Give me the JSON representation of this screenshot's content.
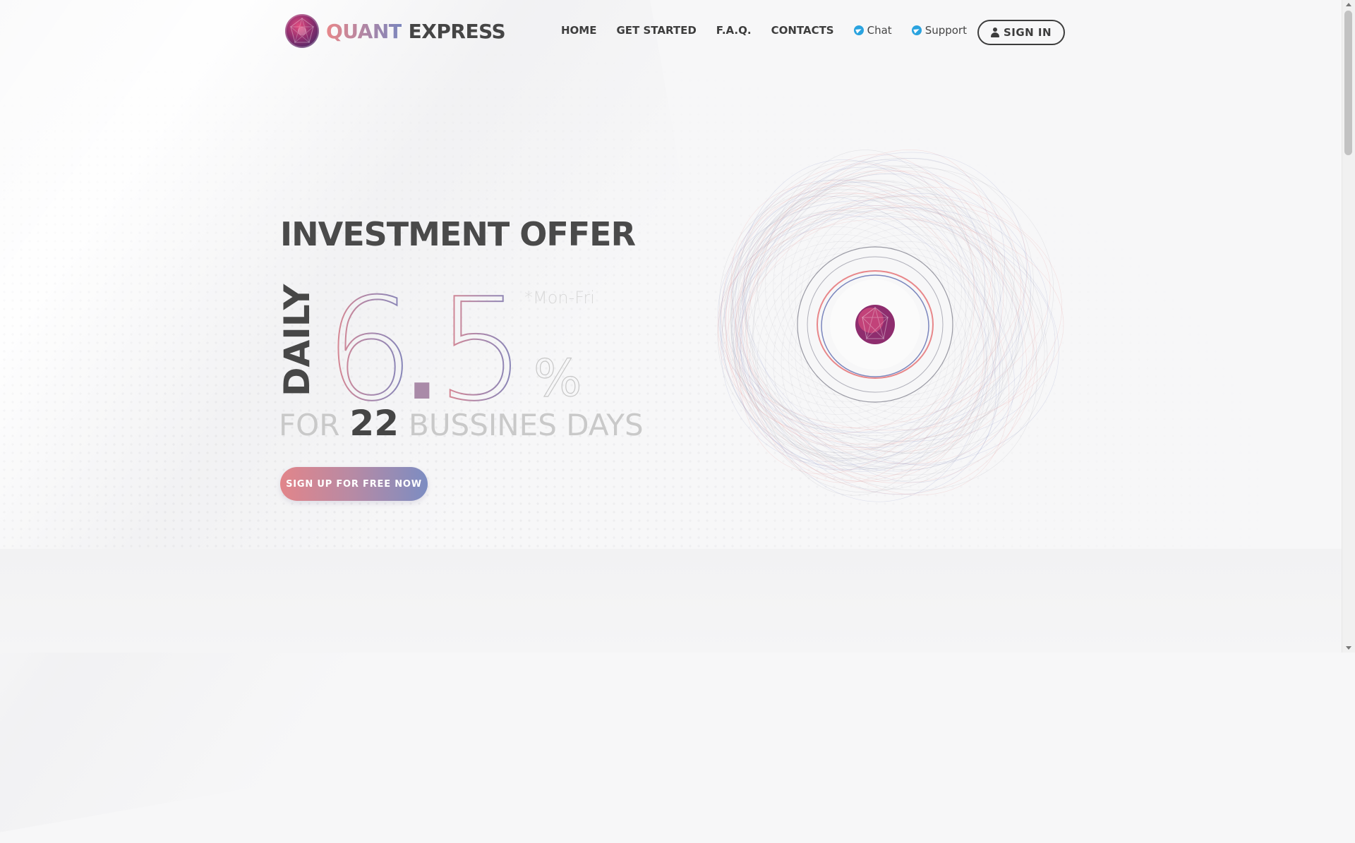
{
  "brand": {
    "word1": "QUANT",
    "word2": "EXPRESS",
    "logo_icon": "crystal-gem-logo"
  },
  "nav": {
    "home": "HOME",
    "get_started": "GET STARTED",
    "faq": "F.A.Q.",
    "contacts": "CONTACTS",
    "chat": "Chat",
    "support": "Support",
    "chat_icon": "telegram-icon",
    "support_icon": "telegram-icon"
  },
  "signin": {
    "label": "SIGN IN",
    "icon": "user-icon"
  },
  "hero": {
    "title": "INVESTMENT OFFER",
    "daily": "DAILY",
    "rate_int": "6",
    "rate_dot": ".",
    "rate_dec": "5",
    "percent": "%",
    "note": "*Mon-Fri",
    "for_word": "FOR",
    "days_count": "22",
    "days_word": "BUSSINES DAYS",
    "cta_label": "SIGN UP FOR FREE NOW"
  },
  "colors": {
    "accent_pink": "#e8878a",
    "accent_blue": "#7b86bd",
    "text_dark": "#454545",
    "telegram": "#2aa3df"
  }
}
